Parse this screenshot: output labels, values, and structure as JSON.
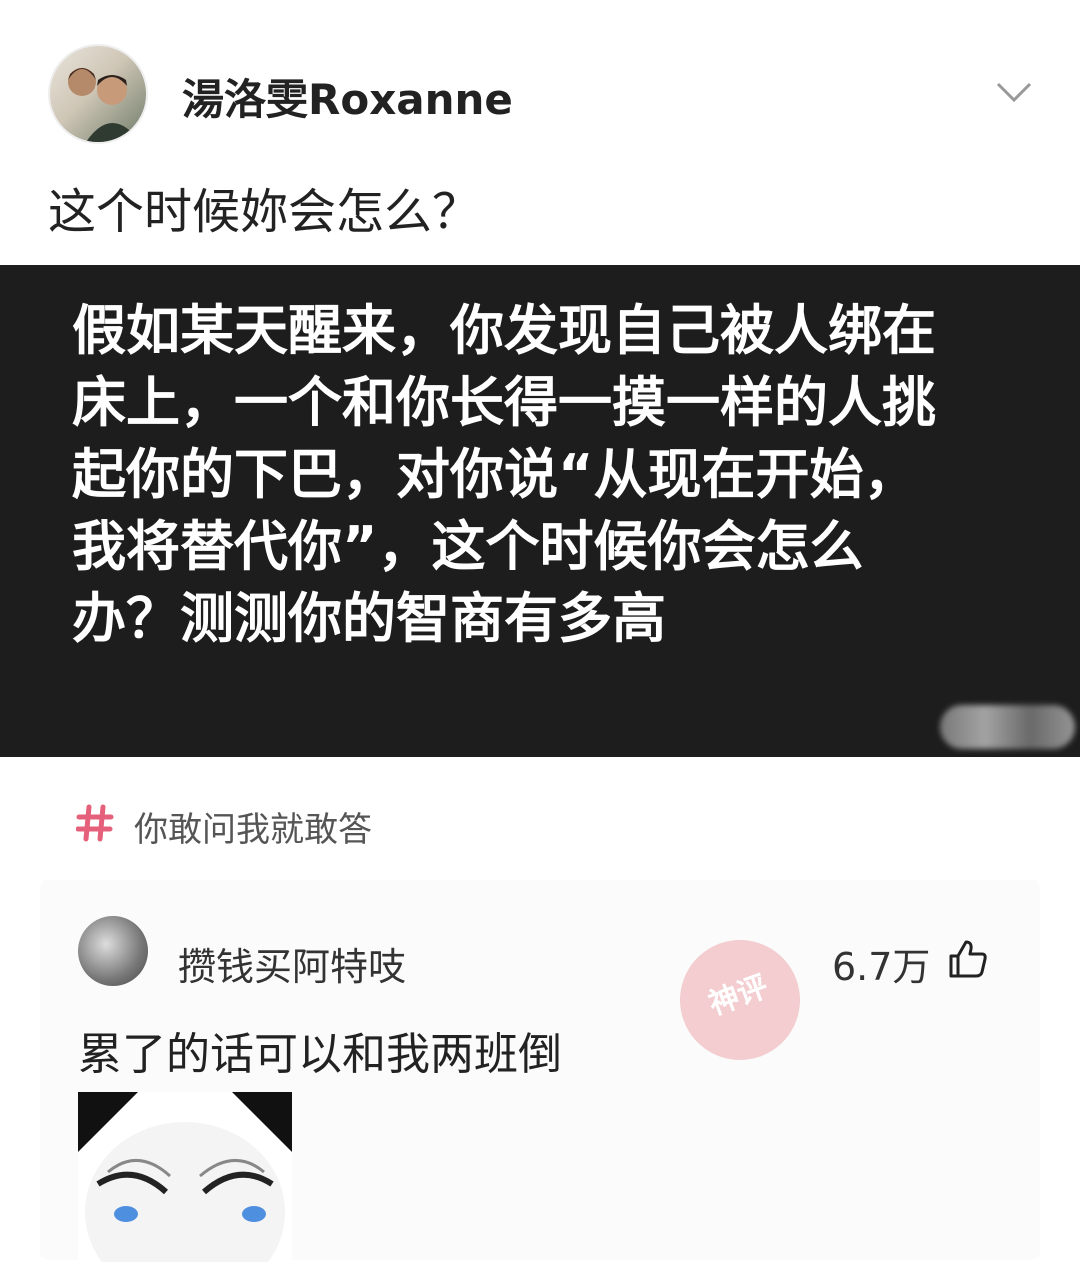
{
  "post": {
    "author_name": "湯洛雯Roxanne",
    "title": "这个时候妳会怎么？",
    "question_text": "假如某天醒来，你发现自己被人绑在\n床上，一个和你长得一摸一样的人挑\n起你的下巴，对你说“从现在开始，\n我将替代你”，这个时候你会怎么\n办？测测你的智商有多高",
    "icons": {
      "avatar": "user-avatar",
      "menu": "chevron-down-icon"
    }
  },
  "topic": {
    "label": "你敢问我就敢答",
    "icon": "hashtag-icon",
    "color": "#e5607a"
  },
  "comment": {
    "username": "攒钱买阿特吱",
    "likes": "6.7万",
    "text": "累了的话可以和我两班倒",
    "stamp_text": "神评",
    "stamp_color": "#e88b93",
    "icons": {
      "like": "thumbs-up-icon",
      "avatar": "user-avatar",
      "image": "meme-face-image"
    }
  }
}
